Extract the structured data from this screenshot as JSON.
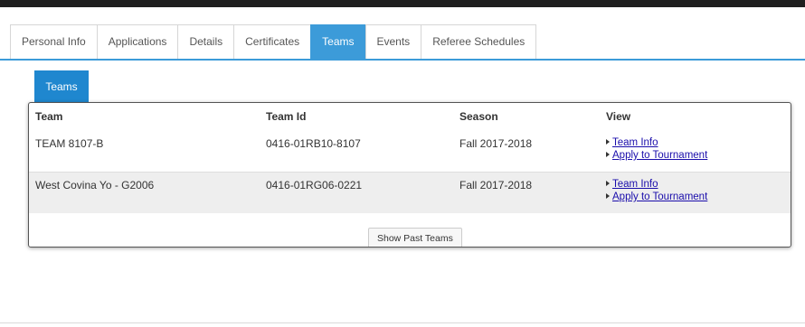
{
  "tabs": {
    "items": [
      {
        "label": "Personal Info"
      },
      {
        "label": "Applications"
      },
      {
        "label": "Details"
      },
      {
        "label": "Certificates"
      },
      {
        "label": "Teams",
        "active": true
      },
      {
        "label": "Events"
      },
      {
        "label": "Referee Schedules"
      }
    ]
  },
  "section": {
    "tab_label": "Teams"
  },
  "table": {
    "headers": {
      "team": "Team",
      "team_id": "Team Id",
      "season": "Season",
      "view": "View"
    },
    "rows": [
      {
        "team": "TEAM 8107-B",
        "team_id": "0416-01RB10-8107",
        "season": "Fall 2017-2018",
        "links": {
          "team_info": "Team Info",
          "apply": "Apply to Tournament"
        }
      },
      {
        "team": "West Covina Yo - G2006",
        "team_id": "0416-01RG06-0221",
        "season": "Fall 2017-2018",
        "links": {
          "team_info": "Team Info",
          "apply": "Apply to Tournament"
        }
      }
    ]
  },
  "footer": {
    "show_past_label": "Show Past Teams"
  },
  "colors": {
    "tab_active": "#3c9bd9",
    "section_tab": "#1f87cf",
    "link": "#1a0dab"
  }
}
